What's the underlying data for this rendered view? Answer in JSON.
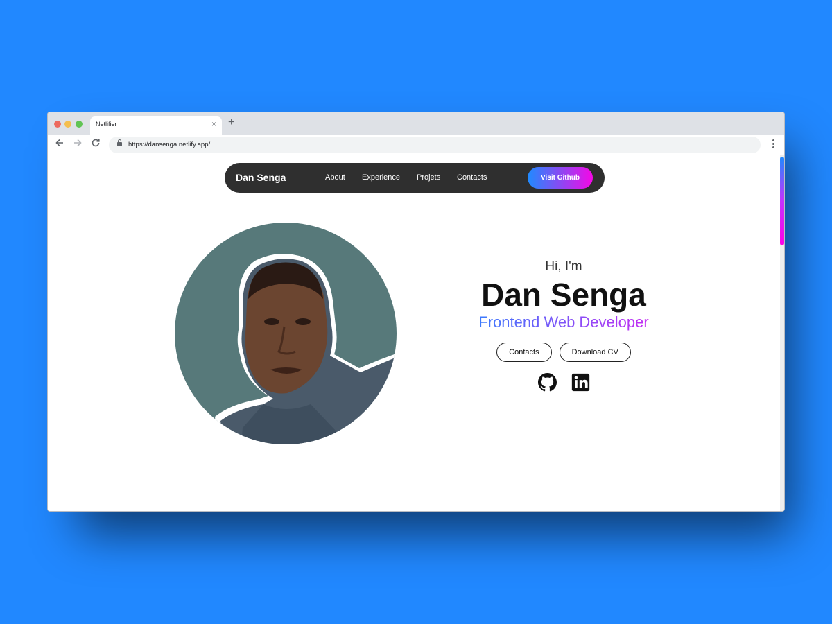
{
  "browser": {
    "tab_title": "Netlifier",
    "tab_close": "×",
    "new_tab": "+",
    "url": "https://dansenga.netlify.app/",
    "back_icon": "arrow-left-icon",
    "forward_icon": "arrow-right-icon",
    "reload_icon": "reload-icon"
  },
  "navbar": {
    "brand": "Dan Senga",
    "links": [
      "About",
      "Experience",
      "Projets",
      "Contacts"
    ],
    "github_button": "Visit Github"
  },
  "hero": {
    "greeting": "Hi, I'm",
    "name": "Dan Senga",
    "role": "Frontend Web Developer",
    "buttons": [
      "Contacts",
      "Download CV"
    ],
    "social_icons": [
      "github-icon",
      "linkedin-icon"
    ]
  },
  "colors": {
    "page_background": "#2188ff",
    "accent_start": "#1f8bff",
    "accent_end": "#f508e6",
    "navbar_background": "#2f2f2f",
    "avatar_background": "#57797a"
  }
}
